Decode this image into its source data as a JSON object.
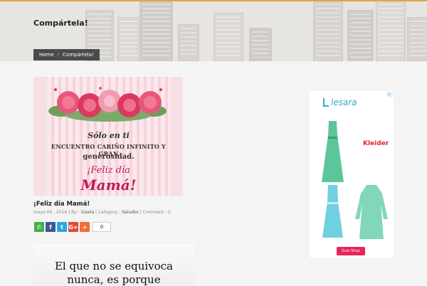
{
  "header": {
    "title": "Compártela!",
    "breadcrumb": [
      "Home",
      "/",
      "Compártela!"
    ]
  },
  "post": {
    "card_lines": [
      "Sólo en ti",
      "ENCUENTRO CARIÑO INFINITO Y GRAN",
      "generosidad.",
      "¡Feliz día",
      "Mamá!"
    ],
    "title": "¡Feliz día Mamá!",
    "meta": {
      "date": "mayo 06 , 2016",
      "by_label": "By :",
      "author": "Gisela",
      "category_label": "Category :",
      "category": "Saludos",
      "comment_label": "Comment : 0"
    },
    "share": [
      {
        "icon": "whatsapp-icon",
        "glyph": "✆",
        "color": "#3fb04a"
      },
      {
        "icon": "facebook-icon",
        "glyph": "f",
        "color": "#3b5998"
      },
      {
        "icon": "twitter-icon",
        "glyph": "t",
        "color": "#2ba9e1"
      },
      {
        "icon": "google-plus-icon",
        "glyph": "G+",
        "color": "#dd4b39"
      },
      {
        "icon": "more-share-icon",
        "glyph": "+",
        "color": "#f26b3a"
      }
    ],
    "share_count": "0"
  },
  "next_post": {
    "quote_lines": [
      "El que no se equivoca",
      "nunca, es porque"
    ]
  },
  "ad": {
    "logo": "lesara",
    "brand": "Kleider",
    "cta": "Zum Shop",
    "badge": "▷"
  },
  "colors": {
    "accent": "#e0a640",
    "rose": "#c2185b",
    "breadcrumb_bg": "#4a4a4a"
  }
}
